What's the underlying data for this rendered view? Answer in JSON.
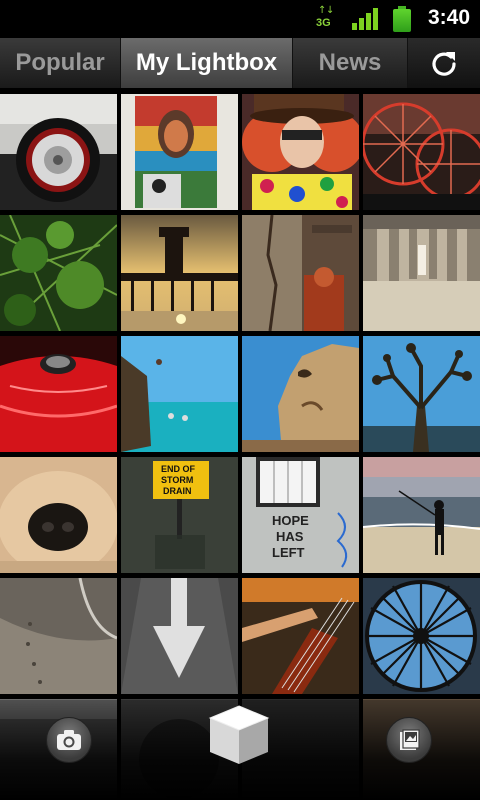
{
  "status_bar": {
    "network": "3G",
    "time": "3:40",
    "signal_bars": 4,
    "battery_level": 1.0,
    "accent_color": "#7dd320"
  },
  "tabs": [
    {
      "label": "Popular",
      "selected": false
    },
    {
      "label": "My Lightbox",
      "selected": true
    },
    {
      "label": "News",
      "selected": false
    }
  ],
  "toolbar": {
    "refresh_icon": "refresh-icon"
  },
  "photos": [
    "car-hubcap",
    "political-poster",
    "clown-mannequin",
    "ferris-wheel",
    "green-foliage",
    "pier-sunset",
    "rusty-wall",
    "pier-underside",
    "red-car-hood",
    "cliff-diver",
    "rock-face",
    "bare-tree",
    "dog-nose",
    "storm-drain-sign",
    "hope-has-left-graffiti",
    "beach-fisherman",
    "concrete-wall",
    "road-arrow",
    "bass-guitar",
    "glass-dome"
  ],
  "bottom_bar": {
    "camera_icon": "camera-icon",
    "lightbox_icon": "lightbox-cube-icon",
    "gallery_icon": "gallery-icon"
  }
}
